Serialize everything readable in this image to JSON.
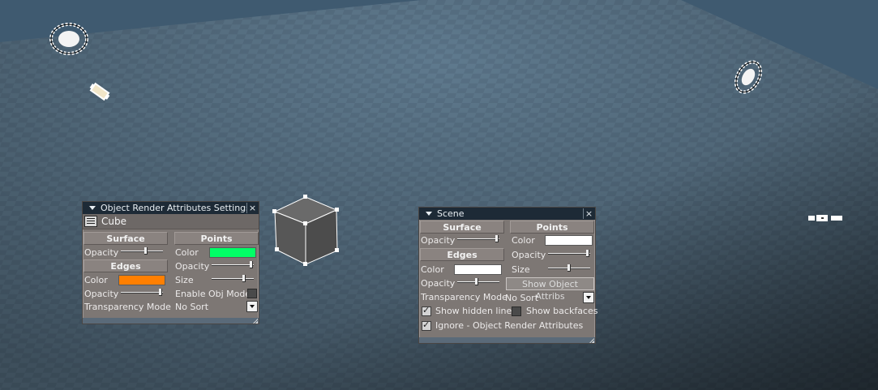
{
  "colors": {
    "edge_color": "#ff7f00",
    "points_color": "#00ff66",
    "scene_points_color": "#ffffff",
    "scene_edges_color": "#ffffff",
    "titlebar": "#1d2a36",
    "panel_bg": "#7d7774"
  },
  "object_panel": {
    "title": "Object Render Attributes Settings",
    "close_icon": "×",
    "object_name": "Cube",
    "surface_header": "Surface",
    "points_header": "Points",
    "edges_header": "Edges",
    "opacity_label": "Opacity",
    "surface_opacity": 0.6,
    "points_color_label": "Color",
    "points_opacity_label": "Opacity",
    "points_opacity": 0.98,
    "edges_color_label": "Color",
    "edges_opacity_label": "Opacity",
    "edges_opacity": 0.98,
    "size_label": "Size",
    "points_size": 0.8,
    "enable_obj_mode_label": "Enable Obj Mode",
    "transparency_mode_label": "Transparency Mode",
    "transparency_mode_value": "No Sort"
  },
  "scene_panel": {
    "title": "Scene",
    "close_icon": "×",
    "surface_header": "Surface",
    "points_header": "Points",
    "edges_header": "Edges",
    "surface_opacity_label": "Opacity",
    "surface_opacity": 0.98,
    "points_color_label": "Color",
    "points_opacity_label": "Opacity",
    "points_opacity": 0.98,
    "points_size_label": "Size",
    "points_size": 0.5,
    "edges_color_label": "Color",
    "edges_opacity_label": "Opacity",
    "edges_opacity": 0.45,
    "show_object_attribs_button": "Show Object Attribs",
    "transparency_mode_label": "Transparency Mode",
    "transparency_mode_value": "No Sort",
    "show_hidden_lines_label": "Show hidden lines",
    "show_hidden_lines": true,
    "show_backfaces_label": "Show backfaces",
    "show_backfaces": false,
    "ignore_label": "Ignore - Object Render Attributes",
    "ignore": true
  }
}
